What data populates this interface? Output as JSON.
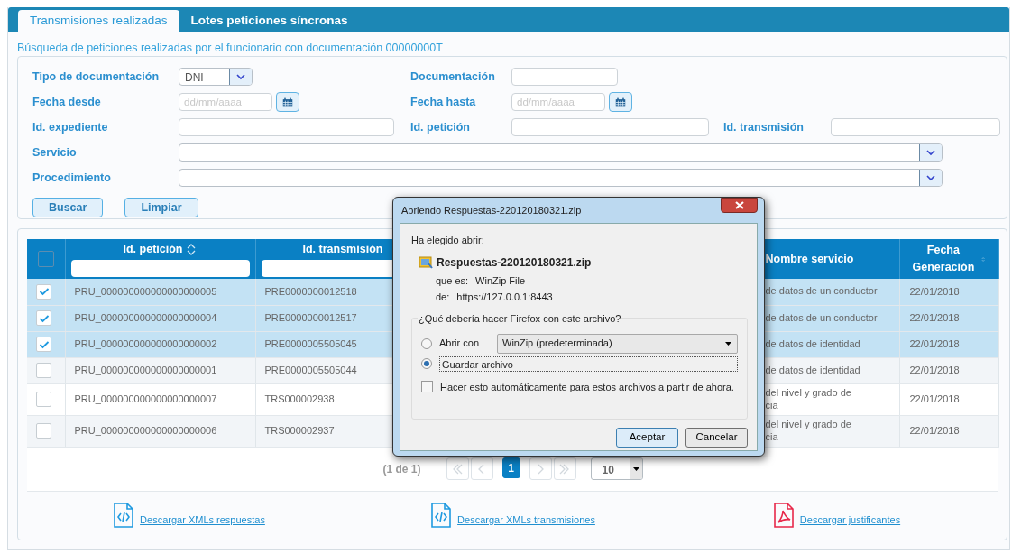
{
  "tabs": [
    {
      "label": "Transmisiones realizadas",
      "selected": true
    },
    {
      "label": "Lotes peticiones síncronas",
      "selected": false
    }
  ],
  "search": {
    "heading": "Búsqueda de peticiones realizadas por el funcionario con documentación 00000000T",
    "rows": [
      [
        {
          "kind": "select",
          "label": "Tipo de documentación",
          "value": "DNI"
        },
        {
          "kind": "text",
          "label": "Documentación"
        }
      ],
      [
        {
          "kind": "date",
          "label": "Fecha desde",
          "placeholder": "dd/mm/aaaa"
        },
        {
          "kind": "date",
          "label": "Fecha hasta",
          "placeholder": "dd/mm/aaaa"
        }
      ],
      [
        {
          "kind": "text",
          "label": "Id. expediente"
        },
        {
          "kind": "text",
          "label": "Id. petición"
        },
        {
          "kind": "text",
          "label": "Id. transmisión"
        }
      ],
      [
        {
          "kind": "wide_select",
          "label": "Servicio"
        }
      ],
      [
        {
          "kind": "wide_select",
          "label": "Procedimiento"
        }
      ]
    ],
    "buttons": [
      "Buscar",
      "Limpiar"
    ]
  },
  "table": {
    "all_checked": false,
    "columns": [
      {
        "label": "Id. petición",
        "sortable": true,
        "filter": true
      },
      {
        "label": "Id. transmisión",
        "filter": true
      },
      {
        "label": "Nombre servicio",
        "filter": false
      },
      {
        "label": "Fecha Generación",
        "sortable": true,
        "filter": false
      }
    ],
    "rows": [
      {
        "selected": true,
        "cells": [
          "PRU_000000000000000000005",
          "PRE0000000012518",
          "de datos de un conductor",
          "22/01/2018"
        ]
      },
      {
        "selected": true,
        "cells": [
          "PRU_000000000000000000004",
          "PRE0000000012517",
          "de datos de un conductor",
          "22/01/2018"
        ]
      },
      {
        "selected": true,
        "cells": [
          "PRU_000000000000000000002",
          "PRE0000005505045",
          "de datos de identidad",
          "22/01/2018"
        ]
      },
      {
        "selected": false,
        "cells": [
          "PRU_000000000000000000001",
          "PRE0000005505044",
          "de datos de identidad",
          "22/01/2018"
        ]
      },
      {
        "selected": false,
        "cells": [
          "PRU_000000000000000000007",
          "TRS000002938",
          "del nivel y grado de\ncia",
          "22/01/2018"
        ]
      },
      {
        "selected": false,
        "cells": [
          "PRU_000000000000000000006",
          "TRS000002937",
          "del nivel y grado de\ncia",
          "22/01/2018"
        ]
      }
    ]
  },
  "pagination": {
    "summary": "(1 de 1)",
    "pages": [
      {
        "label": "1",
        "selected": true
      }
    ],
    "page_size": "10"
  },
  "downloads": [
    {
      "kind": "xml",
      "label": "Descargar XMLs respuestas"
    },
    {
      "kind": "xml",
      "label": "Descargar XMLs transmisiones"
    },
    {
      "kind": "pdf",
      "label": "Descargar justificantes"
    }
  ],
  "dialog": {
    "title": "Abriendo Respuestas-220120180321.zip",
    "intro": "Ha elegido abrir:",
    "file_name": "Respuestas-220120180321.zip",
    "details": [
      {
        "label": "que es:",
        "value": "WinZip File"
      },
      {
        "label": "de:",
        "value": "https://127.0.0.1:8443"
      }
    ],
    "question": "¿Qué debería hacer Firefox con este archivo?",
    "options": [
      {
        "label": "Abrir con",
        "selected": false,
        "app": "WinZip (predeterminada)"
      },
      {
        "label": "Guardar archivo",
        "selected": true
      }
    ],
    "remember": {
      "label": "Hacer esto automáticamente para estos archivos a partir de ahora.",
      "checked": false
    },
    "buttons": [
      {
        "label": "Aceptar",
        "default": true
      },
      {
        "label": "Cancelar",
        "default": false
      }
    ]
  }
}
